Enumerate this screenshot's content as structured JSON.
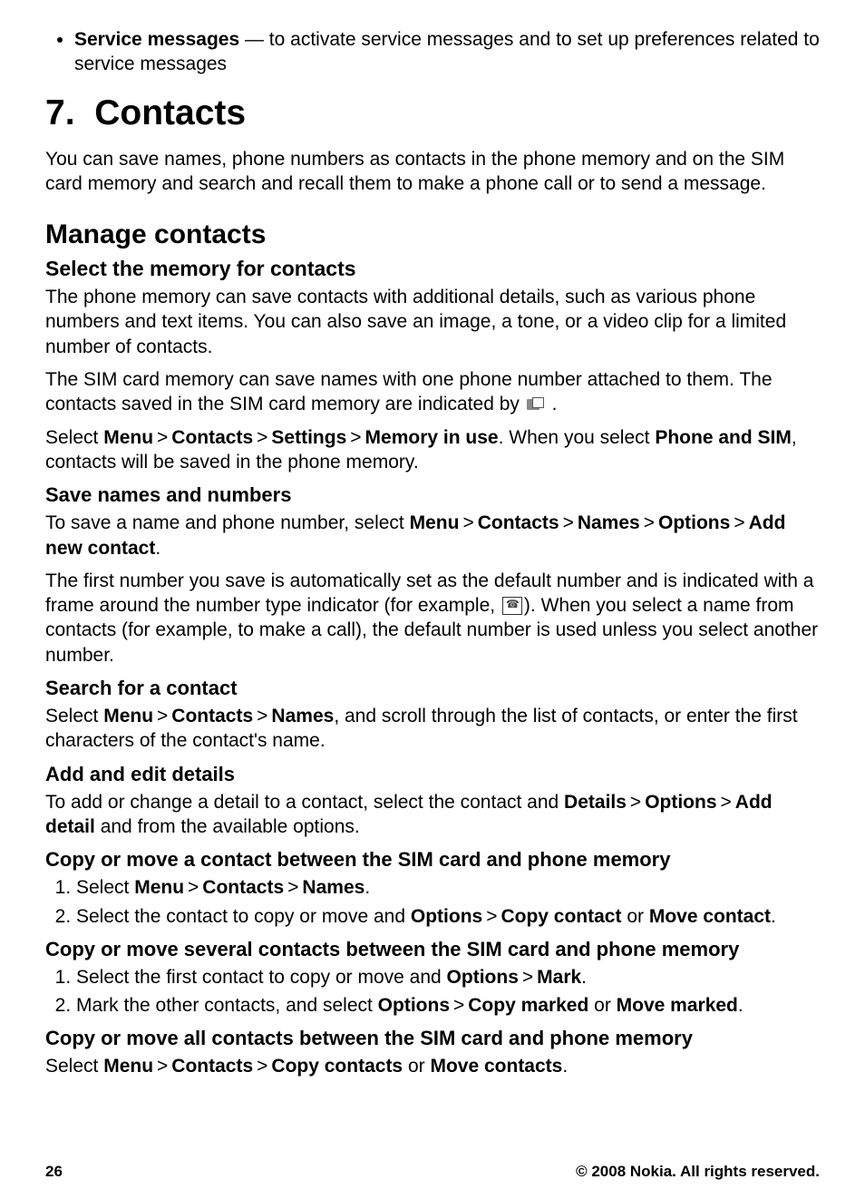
{
  "serviceMessages": {
    "title": "Service messages",
    "desc": " — to activate service messages and to set up preferences related to service messages"
  },
  "chapter": {
    "number": "7.",
    "title": "Contacts"
  },
  "intro": "You can save names, phone numbers as contacts in the phone memory and on the SIM card memory and search and recall them to make a phone call or to send a message.",
  "manage": {
    "title": "Manage contacts",
    "selectMemory": {
      "title": "Select the memory for contacts",
      "p1": "The phone memory can save contacts with additional details, such as various phone numbers and text items. You can also save an image, a tone, or a video clip for a limited number of contacts.",
      "p2a": "The SIM card memory can save names with one phone number attached to them. The contacts saved in the SIM card memory are indicated by ",
      "p2b": " .",
      "p3": {
        "select": "Select ",
        "menu": "Menu",
        "contacts": "Contacts",
        "settings": "Settings",
        "memInUse": "Memory in use",
        "whenSelect": ". When you select ",
        "phoneSim": "Phone and SIM",
        "rest": ", contacts will be saved in the phone memory."
      }
    },
    "saveNames": {
      "title": "Save names and numbers",
      "p1": {
        "pre": "To save a name and phone number, select ",
        "menu": "Menu",
        "contacts": "Contacts",
        "names": "Names",
        "options": "Options",
        "addNew": "Add new contact",
        "period": "."
      },
      "p2a": "The first number you save is automatically set as the default number and is indicated with a frame around the number type indicator (for example, ",
      "p2b": "). When you select a name from contacts (for example, to make a call), the default number is used unless you select another number."
    },
    "search": {
      "title": "Search for a contact",
      "p": {
        "select": "Select ",
        "menu": "Menu",
        "contacts": "Contacts",
        "names": "Names",
        "rest": ", and scroll through the list of contacts, or enter the first characters of the contact's name."
      }
    },
    "addEdit": {
      "title": "Add and edit details",
      "p": {
        "pre": "To add or change a detail to a contact, select the contact and ",
        "details": "Details",
        "options": "Options",
        "addDetail": "Add detail",
        "rest": " and from the available options."
      }
    },
    "copyOne": {
      "title": "Copy or move a contact between the SIM card and phone memory",
      "step1": {
        "select": "Select ",
        "menu": "Menu",
        "contacts": "Contacts",
        "names": "Names",
        "period": "."
      },
      "step2": {
        "pre": "Select the contact to copy or move and ",
        "options": "Options",
        "copy": "Copy contact",
        "or": " or ",
        "move": "Move contact",
        "period": "."
      }
    },
    "copySeveral": {
      "title": "Copy or move several contacts between the SIM card and phone memory",
      "step1": {
        "pre": "Select the first contact to copy or move and ",
        "options": "Options",
        "mark": "Mark",
        "period": "."
      },
      "step2": {
        "pre": "Mark the other contacts, and select ",
        "options": "Options",
        "copy": "Copy marked",
        "or": " or ",
        "move": "Move marked",
        "period": "."
      }
    },
    "copyAll": {
      "title": "Copy or move all contacts between the SIM card and phone memory",
      "p": {
        "select": "Select ",
        "menu": "Menu",
        "contacts": "Contacts",
        "copyC": "Copy contacts",
        "or": " or ",
        "moveC": "Move contacts",
        "period": "."
      }
    }
  },
  "gt": ">",
  "footer": {
    "page": "26",
    "copyright": "© 2008 Nokia. All rights reserved."
  }
}
